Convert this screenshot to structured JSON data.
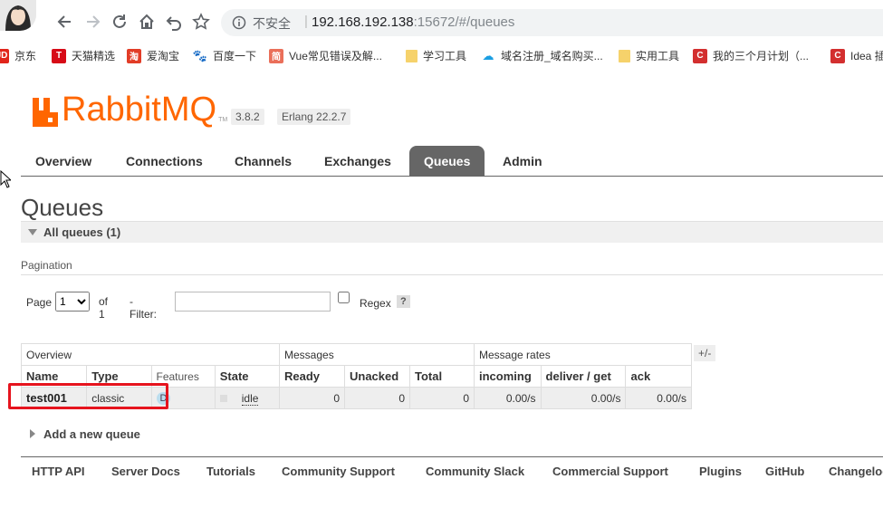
{
  "browser": {
    "insecure_label": "不安全",
    "url_host": "192.168.192.138",
    "url_rest": ":15672/#/queues",
    "bookmarks": [
      {
        "label": "京东",
        "icon": "jd-icon",
        "color": "#e1251b",
        "glyph": "JD"
      },
      {
        "label": "天猫精选",
        "icon": "tmall-icon",
        "color": "#d70b17",
        "glyph": "T"
      },
      {
        "label": "爱淘宝",
        "icon": "taobao-icon",
        "color": "#e23d27",
        "glyph": "淘"
      },
      {
        "label": "百度一下",
        "icon": "baidu-icon",
        "color": "#2932e1",
        "glyph": "🐾"
      },
      {
        "label": "Vue常见错误及解...",
        "icon": "jianshu-icon",
        "color": "#ea6f5a",
        "glyph": "简"
      },
      {
        "label": "学习工具",
        "icon": "folder-icon",
        "color": "#f6d26b",
        "glyph": ""
      },
      {
        "label": "域名注册_域名购买...",
        "icon": "cloud-icon",
        "color": "#1a9ee2",
        "glyph": "☁"
      },
      {
        "label": "实用工具",
        "icon": "folder-icon",
        "color": "#f6d26b",
        "glyph": ""
      },
      {
        "label": "我的三个月计划（...",
        "icon": "csdn-icon",
        "color": "#d32f2f",
        "glyph": "C"
      },
      {
        "label": "Idea 插",
        "icon": "csdn-icon",
        "color": "#d32f2f",
        "glyph": "C"
      }
    ]
  },
  "header": {
    "logo_text": "RabbitMQ",
    "logo_tm": "TM",
    "version": "3.8.2",
    "erlang": "Erlang 22.2.7",
    "brand_color": "#ff6600"
  },
  "tabs": [
    "Overview",
    "Connections",
    "Channels",
    "Exchanges",
    "Queues",
    "Admin"
  ],
  "active_tab": "Queues",
  "page": {
    "title": "Queues",
    "section": "All queues (1)",
    "pagination_label": "Pagination",
    "page_label": "Page",
    "page_value": "1",
    "of_label": "of 1",
    "filter_label": "- Filter:",
    "filter_value": "",
    "regex_label": "Regex",
    "help_label": "?"
  },
  "table": {
    "groups": [
      "Overview",
      "Messages",
      "Message rates"
    ],
    "plus_minus": "+/-",
    "columns": [
      "Name",
      "Type",
      "Features",
      "State",
      "Ready",
      "Unacked",
      "Total",
      "incoming",
      "deliver / get",
      "ack"
    ],
    "rows": [
      {
        "name": "test001",
        "type": "classic",
        "features": "D",
        "state": "idle",
        "ready": "0",
        "unacked": "0",
        "total": "0",
        "incoming": "0.00/s",
        "deliver_get": "0.00/s",
        "ack": "0.00/s"
      }
    ]
  },
  "add_queue": "Add a new queue",
  "footer": [
    "HTTP API",
    "Server Docs",
    "Tutorials",
    "Community Support",
    "Community Slack",
    "Commercial Support",
    "Plugins",
    "GitHub",
    "Changelog"
  ]
}
